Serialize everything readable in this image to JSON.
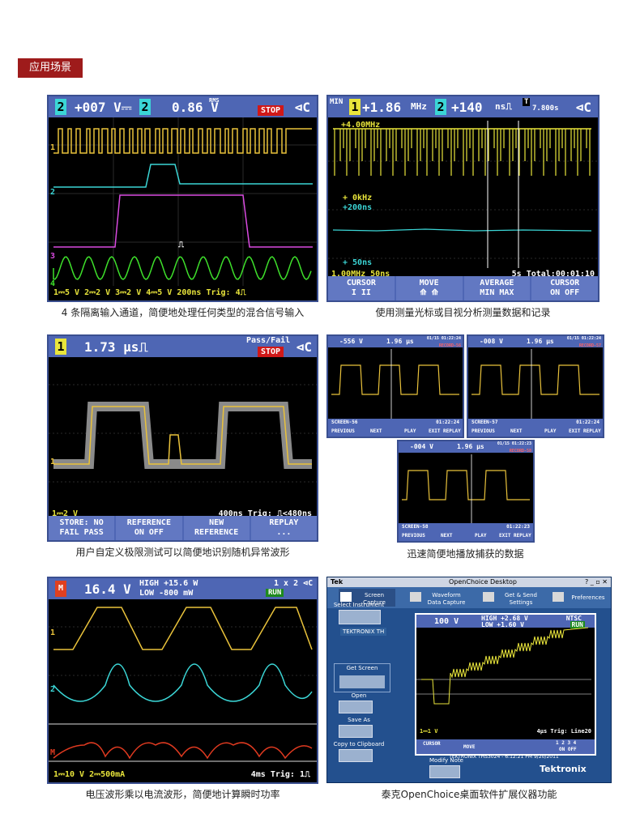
{
  "section_title": "应用场景",
  "captions": {
    "p1": "4 条隔离输入通道，简便地处理任何类型的混合信号输入",
    "p2": "使用测量光标或目视分析测量数据和记录",
    "p3": "用户自定义极限测试可以简便地识别随机异常波形",
    "p4": "迅速简便地播放捕获的数据",
    "p5": "电压波形乘以电流波形，简便地计算瞬时功率",
    "p6": "泰克OpenChoice桌面软件扩展仪器功能"
  },
  "panel1": {
    "ch_a": "2",
    "val_a": "+007 V⎓",
    "ch_b": "2",
    "val_b": "0.86 V",
    "rms": "RMS",
    "status": "STOP",
    "trace_labels": [
      "1",
      "2",
      "3",
      "4"
    ],
    "marker": "⎍",
    "bottom": "1⎓5 V  2⎓2 V  3⎓2 V  4⎓5 V  200ns Trig: 4⎍",
    "colors": {
      "ch1": "#e9c23b",
      "ch2": "#3bd6d6",
      "ch3": "#d94be0",
      "ch4": "#3ee02b"
    }
  },
  "panel2": {
    "min": "MIN",
    "ch_a": "1",
    "val_a": "+1.86",
    "unit_a": "MHz",
    "ch_b": "2",
    "val_b": "+140",
    "unit_b": "ns⎍",
    "t_label": "T",
    "t_val": "7.800s",
    "upper": "+4.00MHz",
    "mid1": "+  0kHz",
    "mid2": "+200ns",
    "lower": "+ 50ns",
    "bottom_left": "1.00MHz   50ns",
    "bottom_right": "5s  Total:00:01:10",
    "softkeys": [
      {
        "top": "CURSOR",
        "bottom": "I    II"
      },
      {
        "top": "MOVE",
        "bottom": "⟰ ⟰"
      },
      {
        "top": "AVERAGE",
        "bottom": "MIN  MAX"
      },
      {
        "top": "CURSOR",
        "bottom": "ON   OFF"
      }
    ]
  },
  "panel3": {
    "ch": "1",
    "val": "1.73 µs⎍",
    "pf": "Pass/Fail",
    "status": "STOP",
    "trace_label": "1",
    "bottom_left": "1⎓2 V",
    "bottom_right": "400ns Trig: ⎍<480ns",
    "softkeys": [
      {
        "top": "STORE: NO",
        "bottom": "FAIL PASS"
      },
      {
        "top": "REFERENCE",
        "bottom": "ON  OFF"
      },
      {
        "top": "NEW",
        "bottom": "REFERENCE"
      },
      {
        "top": "REPLAY",
        "bottom": "..."
      }
    ]
  },
  "panel4": {
    "screens": [
      {
        "val": "-556 V",
        "t": "1.96 µs",
        "date": "01/15 01:22:24",
        "rec": "RECORD-56",
        "screen": "SCREEN-56",
        "time": "01:22:24"
      },
      {
        "val": "-008 V",
        "t": "1.96 µs",
        "date": "01/15 01:22:24",
        "rec": "RECORD-57",
        "screen": "SCREEN-57",
        "time": "01:22:24"
      },
      {
        "val": "-004 V",
        "t": "1.96 µs",
        "date": "01/15 01:22:23",
        "rec": "RECORD-58",
        "screen": "SCREEN-58",
        "time": "01:22:23"
      }
    ],
    "keys": [
      "PREVIOUS",
      "NEXT",
      "PLAY",
      "EXIT REPLAY"
    ]
  },
  "panel5": {
    "val": "16.4 V",
    "high": "HIGH +15.6 W",
    "low": "LOW  -800 mW",
    "zoom": "1 x 2 ⊲C",
    "status": "RUN",
    "bottom": "1⎓10 V  2⎓500mA",
    "bottom_right": "4ms Trig: 1⎍",
    "trace_labels": [
      "1",
      "2",
      "M"
    ]
  },
  "panel6": {
    "app_name": "Tek",
    "window_title": "OpenChoice Desktop",
    "tabs": [
      "Screen Capture",
      "Waveform Data Capture",
      "Get & Send Settings",
      "Preferences"
    ],
    "select_instrument": "Select Instrument",
    "instrument": "TEKTRONIX TH",
    "get_screen": "Get Screen",
    "open": "Open",
    "save_as": "Save As",
    "copy": "Copy to Clipboard",
    "modify": "Modify Note",
    "inner_val": "100 V",
    "inner_high": "HIGH +2.68 V",
    "inner_low": "LOW  +1.60 V",
    "inner_ntsc": "NTSC",
    "inner_run": "RUN",
    "inner_bottom": "1⎓1 V",
    "inner_bottom_right": "4µs Trig: Line20",
    "inner_keys": [
      "CURSOR",
      "MOVE",
      "1 2 3 4",
      "ON OFF"
    ],
    "footer": "TEKTRONIX THS3024 - 6:12:21 PM  9/20/2011",
    "brand": "Tektronix"
  }
}
